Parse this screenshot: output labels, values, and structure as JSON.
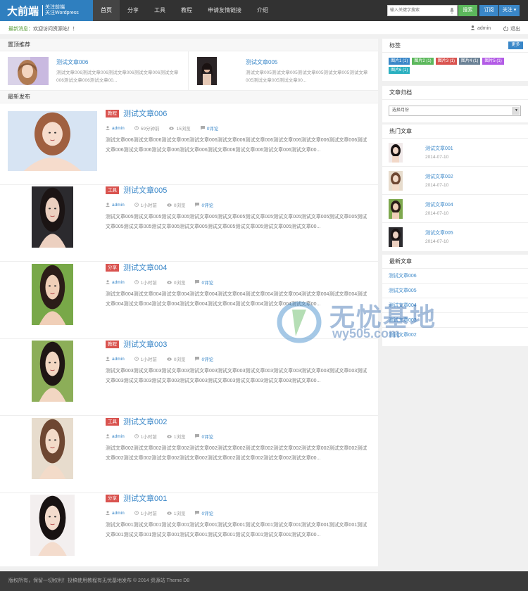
{
  "header": {
    "logo_main": "大前端",
    "logo_sub1": "关注前端",
    "logo_sub2": "关注Wordpress",
    "nav": [
      "首页",
      "分享",
      "工具",
      "教程",
      "申请友情链接",
      "介绍"
    ],
    "search_placeholder": "输入关键字搜索",
    "search_btn": "搜索",
    "subscribe_btn": "订阅",
    "follow_btn": "关注"
  },
  "infobar": {
    "notice_label": "最新消息：",
    "notice_text": "欢迎访问资源站！！",
    "user": "admin",
    "logout": "退出"
  },
  "main": {
    "top_title": "置顶推荐",
    "top_items": [
      {
        "title": "测试文章006",
        "excerpt": "测试文章006测试文章006测试文章006测试文章006测试文章006测试文章006测试文章00..."
      },
      {
        "title": "测试文章005",
        "excerpt": "测试文章005测试文章005测试文章005测试文章005测试文章005测试文章005测试文章00..."
      }
    ],
    "latest_title": "最新发布",
    "posts": [
      {
        "tag": "教程",
        "title": "测试文章006",
        "author": "admin",
        "time": "59分钟前",
        "views": "15浏览",
        "comments": "0评论",
        "excerpt": "测试文章006测试文章006测试文章006测试文章006测试文章006测试文章006测试文章006测试文章006测试文章006测试文章006测试文章006测试文章006测试文章006测试文章006测试文章006测试文章006测试文章00..."
      },
      {
        "tag": "工具",
        "title": "测试文章005",
        "author": "admin",
        "time": "1小时前",
        "views": "0浏览",
        "comments": "0评论",
        "excerpt": "测试文章005测试文章005测试文章005测试文章005测试文章005测试文章005测试文章005测试文章005测试文章005测试文章005测试文章005测试文章005测试文章005测试文章005测试文章005测试文章005测试文章00..."
      },
      {
        "tag": "分享",
        "title": "测试文章004",
        "author": "admin",
        "time": "1小时前",
        "views": "0浏览",
        "comments": "0评论",
        "excerpt": "测试文章004测试文章004测试文章004测试文章004测试文章004测试文章004测试文章004测试文章004测试文章004测试文章004测试文章004测试文章004测试文章004测试文章004测试文章004测试文章004测试文章00..."
      },
      {
        "tag": "教程",
        "title": "测试文章003",
        "author": "admin",
        "time": "1小时前",
        "views": "0浏览",
        "comments": "0评论",
        "excerpt": "测试文章003测试文章003测试文章003测试文章003测试文章003测试文章003测试文章003测试文章003测试文章003测试文章003测试文章003测试文章003测试文章003测试文章003测试文章003测试文章003测试文章00..."
      },
      {
        "tag": "工具",
        "title": "测试文章002",
        "author": "admin",
        "time": "1小时前",
        "views": "1浏览",
        "comments": "0评论",
        "excerpt": "测试文章002测试文章002测试文章002测试文章002测试文章002测试文章002测试文章002测试文章002测试文章002测试文章002测试文章002测试文章002测试文章002测试文章002测试文章002测试文章002测试文章00..."
      },
      {
        "tag": "分享",
        "title": "测试文章001",
        "author": "admin",
        "time": "1小时前",
        "views": "1浏览",
        "comments": "0评论",
        "excerpt": "测试文章001测试文章001测试文章001测试文章001测试文章001测试文章001测试文章001测试文章001测试文章001测试文章001测试文章001测试文章001测试文章001测试文章001测试文章001测试文章001测试文章00..."
      }
    ]
  },
  "sidebar": {
    "tags_title": "标签",
    "more_btn": "更多",
    "tags": [
      {
        "label": "图片1 (1)",
        "color": "#3a87c8"
      },
      {
        "label": "图片2 (1)",
        "color": "#5cb85c"
      },
      {
        "label": "图片3 (1)",
        "color": "#d9534f"
      },
      {
        "label": "图片4 (1)",
        "color": "#6c8296"
      },
      {
        "label": "图片5 (1)",
        "color": "#b35ce6"
      },
      {
        "label": "图片6 (1)",
        "color": "#2ab0c0"
      }
    ],
    "archive_title": "文章归档",
    "archive_select": "选择月份",
    "hot_title": "热门文章",
    "hot": [
      {
        "title": "测试文章001",
        "date": "2014-07-10"
      },
      {
        "title": "测试文章002",
        "date": "2014-07-10"
      },
      {
        "title": "测试文章004",
        "date": "2014-07-10"
      },
      {
        "title": "测试文章005",
        "date": "2014-07-10"
      }
    ],
    "new_title": "最新文章",
    "new_posts": [
      "测试文章006",
      "测试文章005",
      "测试文章004",
      "测试文章003",
      "测试文章002"
    ]
  },
  "footer": {
    "text": "版权所有，保留一切权利！投稿使用教程有无忧基地发布 © 2014 资源站    Theme D8"
  },
  "watermark": {
    "text": "无忧基地",
    "url": "wy505.com"
  }
}
